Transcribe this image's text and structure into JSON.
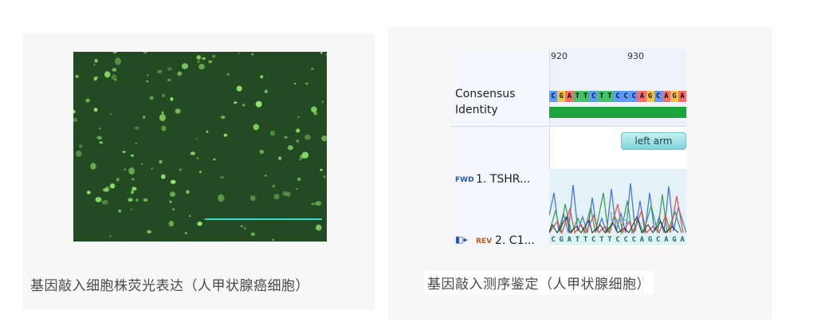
{
  "left_caption": "基因敲入细胞株荧光表达（人甲状腺癌细胞）",
  "right_caption": "基因敲入测序鉴定（人甲状腺细胞）",
  "sequence_view": {
    "ruler": [
      "920",
      "930"
    ],
    "consensus_label": "Consensus",
    "identity_label": "Identity",
    "consensus_bases": "CGATTCTTCCCAGCAGA",
    "arm_label": "left arm",
    "forward_tag": "FWD",
    "read1_label": "1. TSHR...",
    "reverse_tag": "REV",
    "read2_label": "2. C1...",
    "read2_bases": "CGATTCTTCCCAGCAGA"
  },
  "colors": {
    "A": "#ff6b6b",
    "C": "#5b9bff",
    "G": "#f6c445",
    "T": "#43c46b",
    "identity": "#1ca33b",
    "micro_bg": "#244a24",
    "cell": "#8ee86b"
  }
}
